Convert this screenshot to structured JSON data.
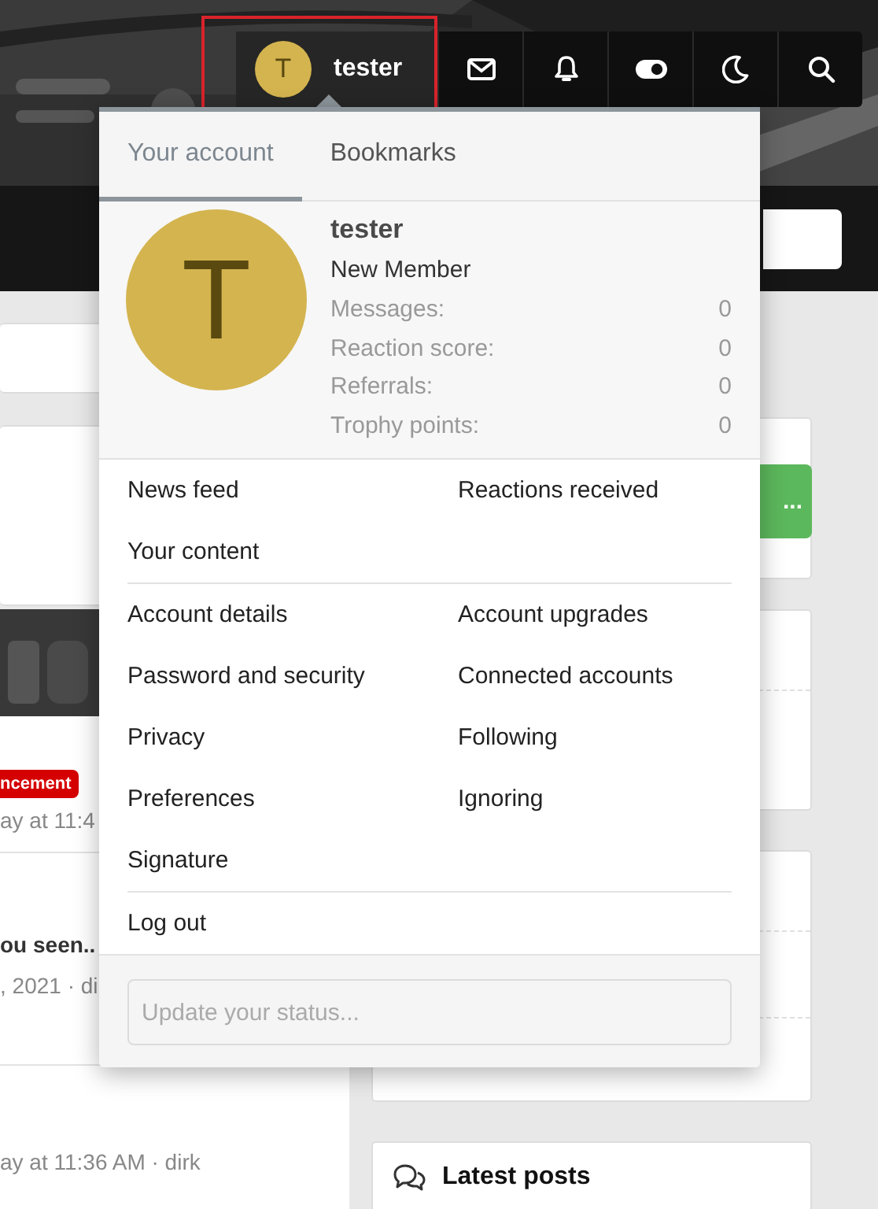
{
  "top_nav": {
    "user": {
      "avatar_letter": "T",
      "name": "tester",
      "highlighted": true,
      "selected": true
    }
  },
  "account_menu": {
    "tabs": [
      {
        "label": "Your account",
        "selected": true
      },
      {
        "label": "Bookmarks",
        "selected": false
      }
    ],
    "profile": {
      "avatar_letter": "T",
      "name": "tester",
      "user_title": "New Member",
      "stats": [
        {
          "label": "Messages:",
          "value": "0"
        },
        {
          "label": "Reaction score:",
          "value": "0"
        },
        {
          "label": "Referrals:",
          "value": "0"
        },
        {
          "label": "Trophy points:",
          "value": "0"
        }
      ]
    },
    "link_groups": [
      [
        "News feed",
        "Reactions received",
        "Your content"
      ],
      [
        "Account details",
        "Account upgrades",
        "Password and security",
        "Connected accounts",
        "Privacy",
        "Following",
        "Preferences",
        "Ignoring",
        "Signature"
      ],
      [
        "Log out"
      ]
    ],
    "status_field": {
      "placeholder": "Update your status..."
    }
  },
  "page_behind": {
    "announcement_tag": "ncement",
    "thread_meta": "ay at 11:4",
    "thread2_title": "ou seen..",
    "thread2_meta": ", 2021 · di",
    "thread3_meta": "ay at 11:36 AM · dirk",
    "button_label": "...",
    "latest_posts_title": "Latest posts"
  }
}
